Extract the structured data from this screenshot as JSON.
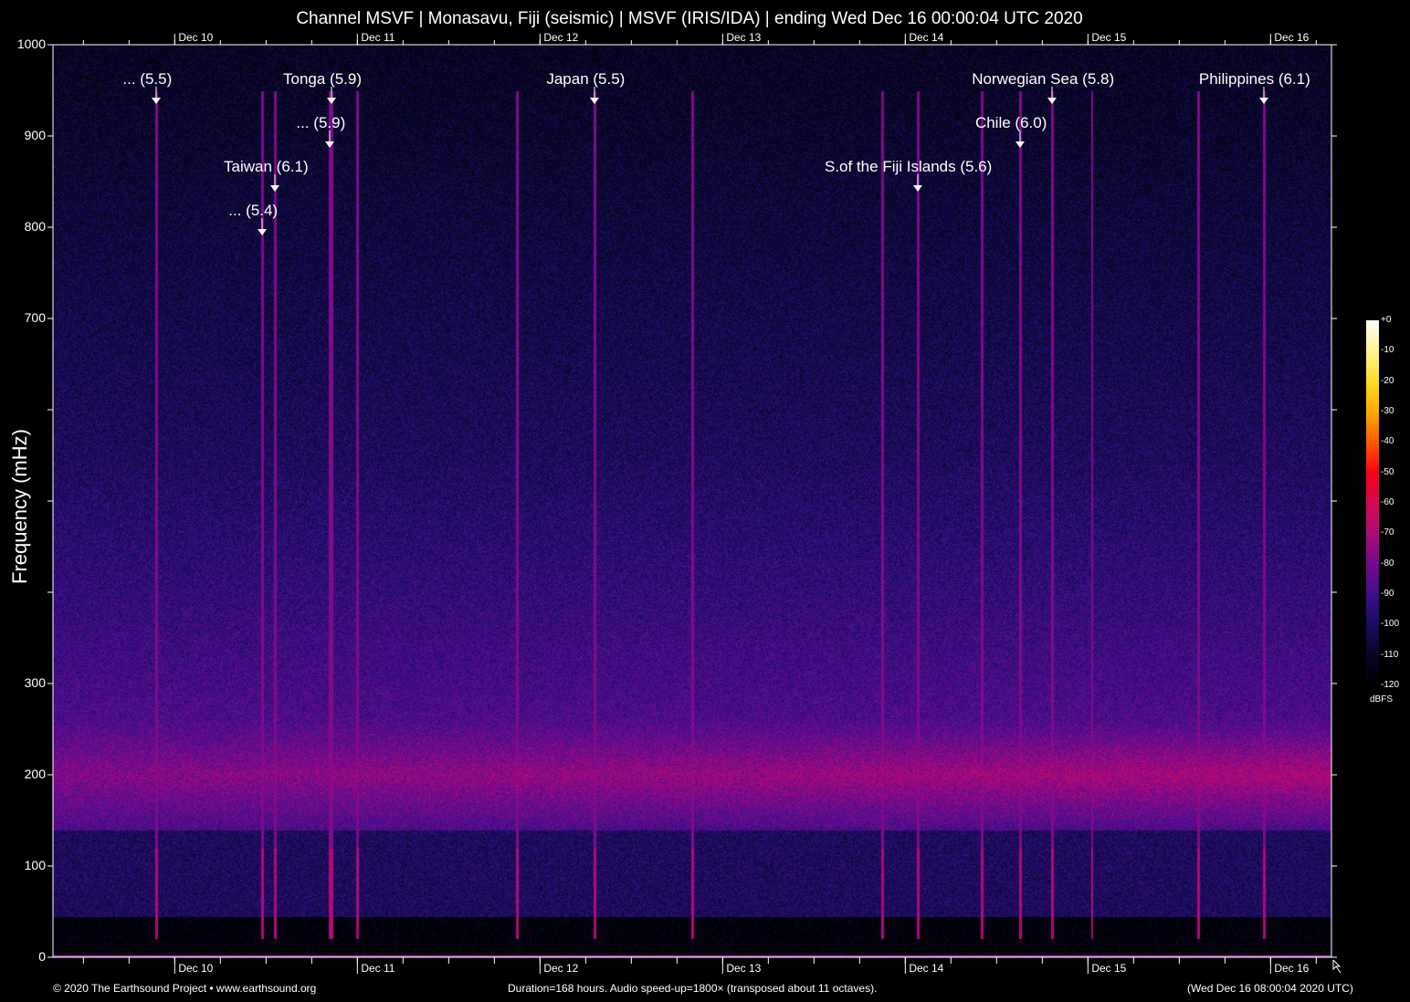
{
  "title": "Channel MSVF | Monasavu, Fiji (seismic) | MSVF (IRIS/IDA) | ending Wed Dec 16 00:00:04 UTC 2020",
  "chart_data": {
    "type": "heatmap",
    "title": "Channel MSVF | Monasavu, Fiji (seismic) | MSVF (IRIS/IDA) | ending Wed Dec 16 00:00:04 UTC 2020",
    "ylabel": "Frequency (mHz)",
    "ylim": [
      0,
      1000
    ],
    "y_ticks": [
      0,
      100,
      200,
      300,
      400,
      500,
      600,
      700,
      800,
      900,
      1000
    ],
    "y_tick_labels": [
      "0",
      "100",
      "200",
      "300",
      "",
      "",
      "",
      "700",
      "800",
      "900",
      "1000"
    ],
    "x_range_hours": [
      0,
      168
    ],
    "x_start": "Dec 9 08:00 UTC",
    "x_day_ticks": [
      {
        "label": "Dec 10",
        "hour": 16
      },
      {
        "label": "Dec 11",
        "hour": 40
      },
      {
        "label": "Dec 12",
        "hour": 64
      },
      {
        "label": "Dec 13",
        "hour": 88
      },
      {
        "label": "Dec 14",
        "hour": 112
      },
      {
        "label": "Dec 15",
        "hour": 136
      },
      {
        "label": "Dec 16",
        "hour": 160
      }
    ],
    "colorbar": {
      "label": "dBFS",
      "range": [
        -120,
        0
      ],
      "ticks": [
        "+0",
        "-10",
        "-20",
        "-30",
        "-40",
        "-50",
        "-60",
        "-70",
        "-80",
        "-90",
        "-100",
        "-110",
        "-120"
      ]
    },
    "events": [
      {
        "label": "... (5.5)",
        "hour": 13.6,
        "level": 1
      },
      {
        "label": "Tonga (5.9)",
        "hour": 36.6,
        "level": 1
      },
      {
        "label": "... (5.9)",
        "hour": 36.4,
        "level": 2
      },
      {
        "label": "Taiwan (6.1)",
        "hour": 29.2,
        "level": 3
      },
      {
        "label": "... (5.4)",
        "hour": 27.5,
        "level": 4
      },
      {
        "label": "Japan (5.5)",
        "hour": 71.2,
        "level": 1
      },
      {
        "label": "S.of the Fiji Islands (5.6)",
        "hour": 113.6,
        "level": 3
      },
      {
        "label": "Norwegian Sea (5.8)",
        "hour": 131.3,
        "level": 1
      },
      {
        "label": "Chile (6.0)",
        "hour": 127.1,
        "level": 2
      },
      {
        "label": "Philippines (6.1)",
        "hour": 159.1,
        "level": 1
      }
    ]
  },
  "footer": {
    "copyright": "© 2020 The Earthsound Project • www.earthsound.org",
    "info": "Duration=168 hours. Audio speed-up=1800× (transposed about 11 octaves).",
    "local_time": "(Wed Dec 16 08:00:04 2020 UTC)"
  }
}
